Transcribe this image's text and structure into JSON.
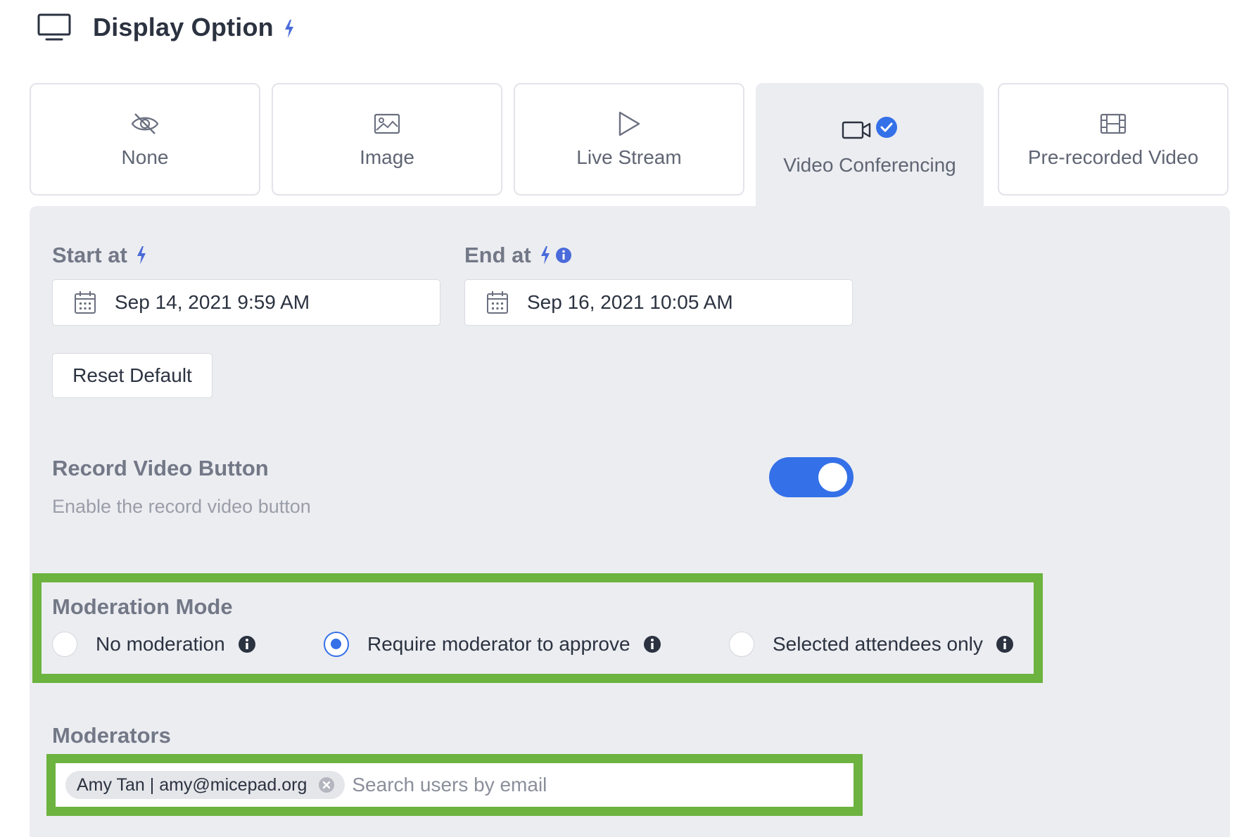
{
  "header": {
    "title": "Display Option",
    "icon": "monitor-icon"
  },
  "tabs": [
    {
      "label": "None",
      "icon": "eye-off-icon",
      "active": false
    },
    {
      "label": "Image",
      "icon": "image-icon",
      "active": false
    },
    {
      "label": "Live Stream",
      "icon": "play-icon",
      "active": false
    },
    {
      "label": "Video Conferencing",
      "icon": "video-camera-icon",
      "active": true
    },
    {
      "label": "Pre-recorded Video",
      "icon": "film-icon",
      "active": false
    }
  ],
  "schedule": {
    "start_label": "Start at",
    "start_value": "Sep 14, 2021 9:59 AM",
    "end_label": "End at",
    "end_value": "Sep 16, 2021 10:05 AM",
    "reset_label": "Reset Default"
  },
  "record": {
    "title": "Record Video Button",
    "subtitle": "Enable the record video button",
    "enabled": true
  },
  "moderation": {
    "title": "Moderation Mode",
    "options": [
      {
        "label": "No moderation",
        "selected": false
      },
      {
        "label": "Require moderator to approve",
        "selected": true
      },
      {
        "label": "Selected attendees only",
        "selected": false
      }
    ]
  },
  "moderators": {
    "title": "Moderators",
    "chips": [
      {
        "label": "Amy Tan | amy@micepad.org"
      }
    ],
    "placeholder": "Search users by email"
  },
  "colors": {
    "accent": "#3470e8",
    "bolt": "#4a6bd9",
    "highlight": "#6cb33f",
    "panel_bg": "#ecedf1"
  }
}
